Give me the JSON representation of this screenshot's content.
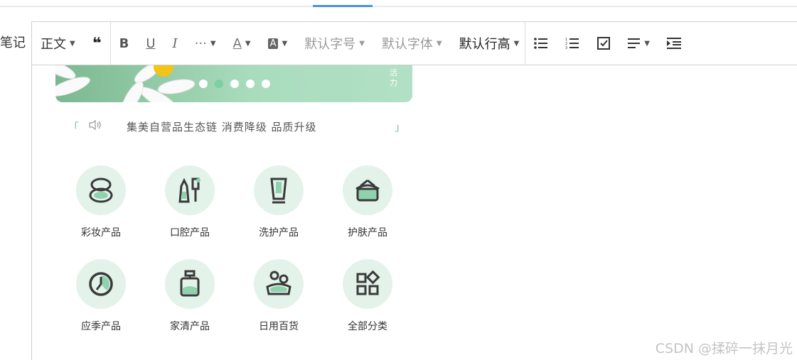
{
  "sidebar": {
    "partial_label": "笔记"
  },
  "toolbar": {
    "paragraph": "正文",
    "quote": "❝",
    "bold": "B",
    "underline": "U",
    "italic": "I",
    "more": "···",
    "font_color": "A",
    "bg_color": "A",
    "font_size": "默认字号",
    "font_family": "默认字体",
    "line_height": "默认行高"
  },
  "banner": {
    "side_text": "活力",
    "active_dot": 1,
    "dot_count": 5
  },
  "notice": {
    "left_bracket": "「",
    "right_bracket": "」",
    "text": "集美自营品生态链 消费降级 品质升级"
  },
  "categories": [
    {
      "label": "彩妆产品",
      "icon": "compact-icon"
    },
    {
      "label": "口腔产品",
      "icon": "toothbrush-icon"
    },
    {
      "label": "洗护产品",
      "icon": "tube-icon"
    },
    {
      "label": "护肤产品",
      "icon": "cream-jar-icon"
    },
    {
      "label": "应季产品",
      "icon": "clock-icon"
    },
    {
      "label": "家清产品",
      "icon": "bottle-icon"
    },
    {
      "label": "日用百货",
      "icon": "basin-icon"
    },
    {
      "label": "全部分类",
      "icon": "category-grid-icon"
    }
  ],
  "watermark": {
    "text": "CSDN @揉碎一抹月光"
  },
  "colors": {
    "accent": "#4a90e2",
    "icon_bg": "#e3f3ea",
    "icon_green": "#8fd3ae",
    "banner_green": "#a9dcbd"
  }
}
